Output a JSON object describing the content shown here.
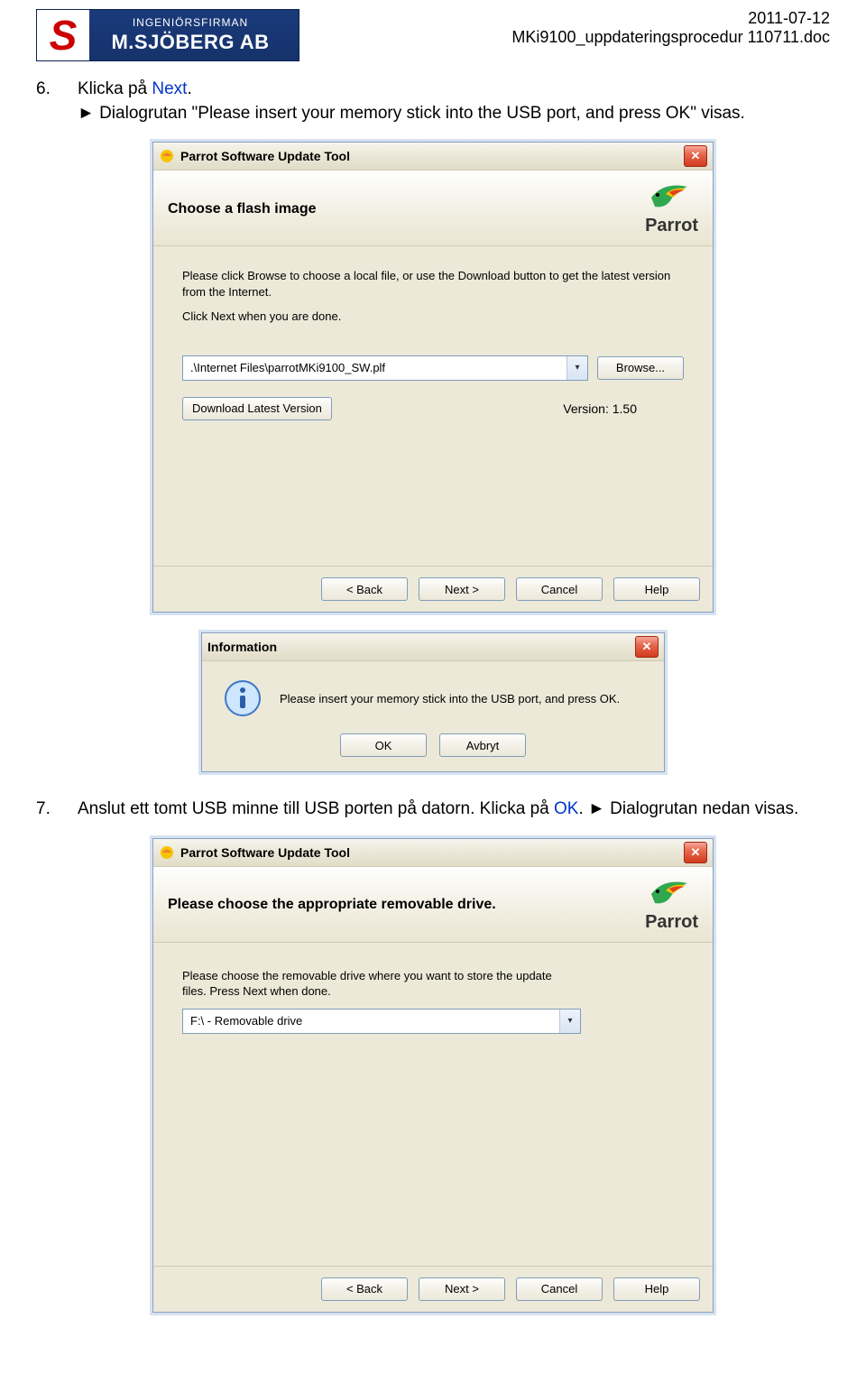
{
  "header": {
    "company_top": "INGENIÖRSFIRMAN",
    "company_name": "M.SJÖBERG AB",
    "date": "2011-07-12",
    "doc_name": "MKi9100_uppdateringsprocedur 110711.doc"
  },
  "step6": {
    "num": "6.",
    "t1": "Klicka på ",
    "link": "Next",
    "t2": ".",
    "quote_prefix": "► Dialogrutan \"",
    "quote_body": "Please insert your memory stick into the USB port, and press OK",
    "quote_suffix": "\" visas."
  },
  "wizard1": {
    "title": "Parrot Software Update Tool",
    "heading": "Choose a flash image",
    "brand": "Parrot",
    "desc1": "Please click Browse to choose a local file, or use the Download button to get the latest version from the Internet.",
    "desc2": "Click Next when you are done.",
    "file_value": ".\\Internet Files\\parrotMKi9100_SW.plf",
    "browse": "Browse...",
    "download": "Download Latest Version",
    "version_label": "Version: 1.50",
    "back": "< Back",
    "next": "Next >",
    "cancel": "Cancel",
    "help": "Help"
  },
  "info_dialog": {
    "title": "Information",
    "message": "Please insert your memory stick into the USB port, and press OK.",
    "ok": "OK",
    "cancel": "Avbryt"
  },
  "step7": {
    "num": "7.",
    "t1": "Anslut ett tomt USB minne till USB porten på datorn. Klicka på ",
    "link": "OK",
    "t2": ". ► Dialogrutan nedan visas."
  },
  "wizard2": {
    "title": "Parrot Software Update Tool",
    "heading": "Please choose the appropriate removable drive.",
    "brand": "Parrot",
    "desc": "Please choose the removable drive where you want to store the update files. Press Next when done.",
    "drive_value": "F:\\ - Removable drive",
    "back": "< Back",
    "next": "Next >",
    "cancel": "Cancel",
    "help": "Help"
  }
}
